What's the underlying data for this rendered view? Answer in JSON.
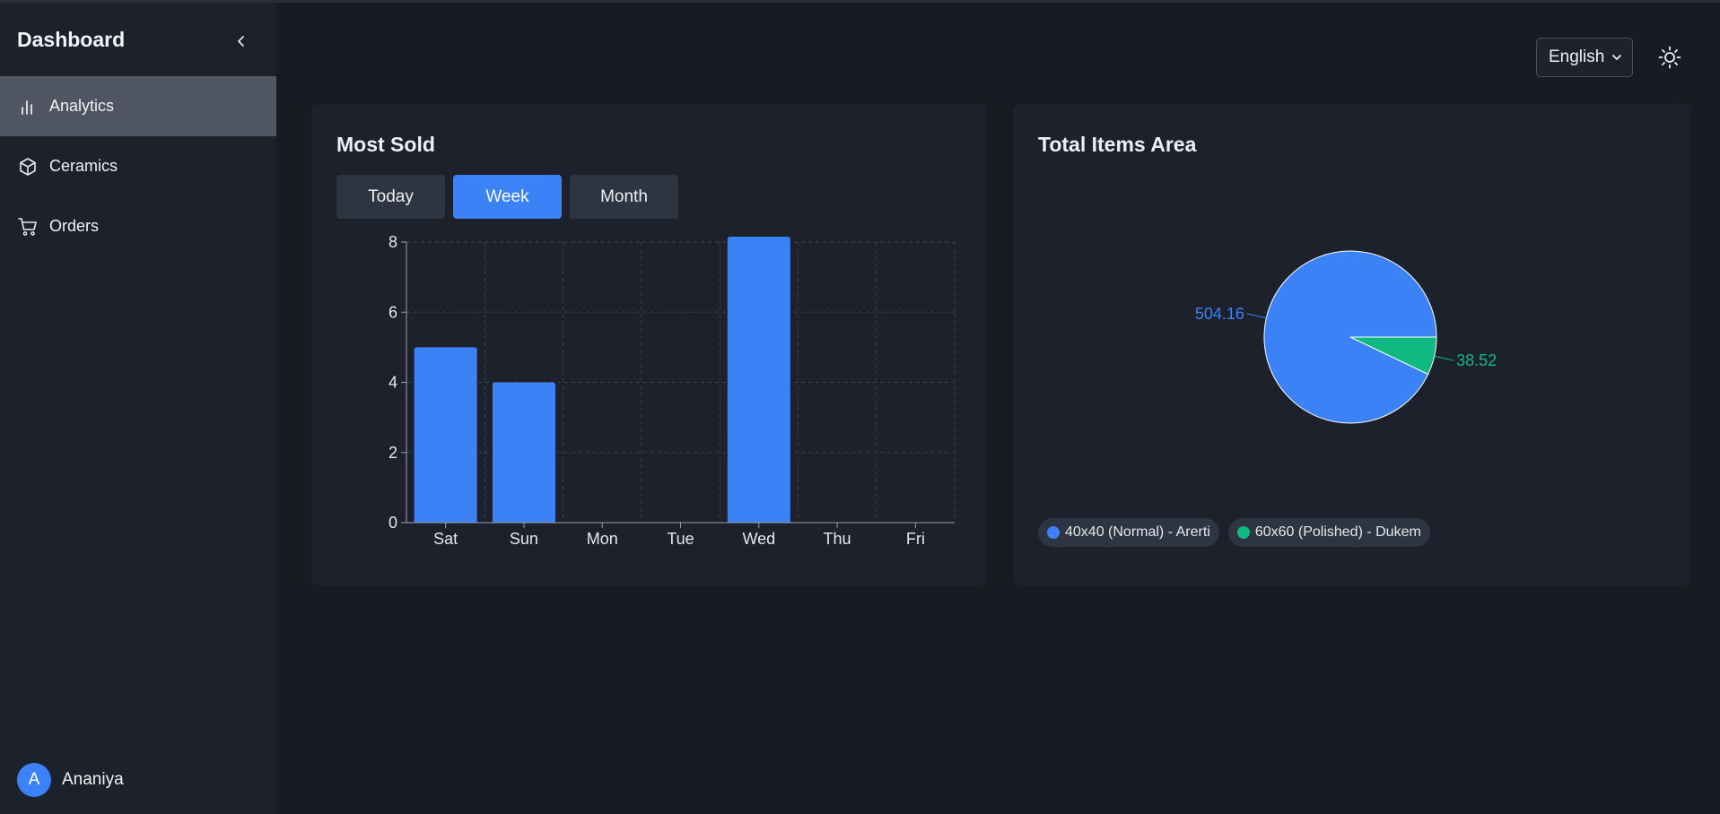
{
  "app": {
    "title": "Dashboard"
  },
  "sidebar": {
    "items": [
      {
        "label": "Analytics",
        "icon": "bar-chart-icon",
        "active": true
      },
      {
        "label": "Ceramics",
        "icon": "box-icon",
        "active": false
      },
      {
        "label": "Orders",
        "icon": "cart-icon",
        "active": false
      }
    ],
    "user": {
      "initial": "A",
      "name": "Ananiya"
    }
  },
  "header": {
    "language": "English",
    "theme_icon": "sun-icon"
  },
  "most_sold": {
    "title": "Most Sold",
    "tabs": [
      {
        "label": "Today",
        "active": false
      },
      {
        "label": "Week",
        "active": true
      },
      {
        "label": "Month",
        "active": false
      }
    ]
  },
  "total_items": {
    "title": "Total Items Area"
  },
  "colors": {
    "accent": "#3b82f6",
    "secondary": "#10b981"
  },
  "chart_data": [
    {
      "type": "bar",
      "categories": [
        "Sat",
        "Sun",
        "Mon",
        "Tue",
        "Wed",
        "Thu",
        "Fri"
      ],
      "values": [
        5,
        4,
        0,
        0,
        8.2,
        0,
        0
      ],
      "yticks": [
        "0",
        "2",
        "4",
        "6",
        "8"
      ],
      "ylim": [
        0,
        8
      ],
      "grid": true,
      "color": "#3b82f6"
    },
    {
      "type": "pie",
      "labels": [
        "40x40 (Normal) - Arerti",
        "60x60 (Polished) - Dukem"
      ],
      "values": [
        504.16,
        38.52
      ],
      "value_labels": [
        "504.16",
        "38.52"
      ],
      "colors": [
        "#3b82f6",
        "#10b981"
      ],
      "legend": "bottom-left"
    }
  ]
}
